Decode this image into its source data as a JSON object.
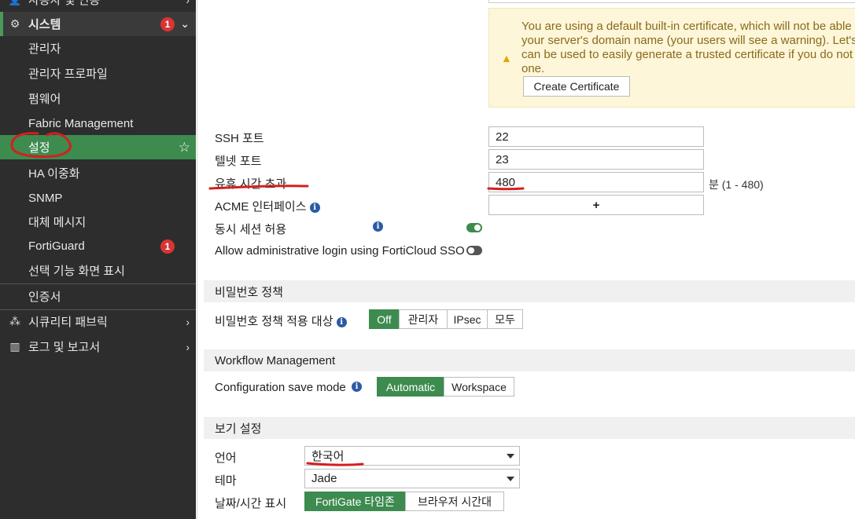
{
  "sidebar": {
    "partial_top_label": "사용자 및 인증",
    "system": {
      "label": "시스템",
      "badge": "1"
    },
    "sub_items": [
      {
        "label": "관리자"
      },
      {
        "label": "관리자 프로파일"
      },
      {
        "label": "펌웨어"
      },
      {
        "label": "Fabric Management"
      },
      {
        "label": "설정"
      },
      {
        "label": "HA 이중화"
      },
      {
        "label": "SNMP"
      },
      {
        "label": "대체 메시지"
      },
      {
        "label": "FortiGuard",
        "badge": "1"
      },
      {
        "label": "선택 기능 화면 표시"
      },
      {
        "label": "인증서"
      }
    ],
    "security_fabric": {
      "label": "시큐리티 패브릭"
    },
    "log_report": {
      "label": "로그 및 보고서"
    },
    "colors": {
      "bg": "#2d2d2d",
      "selected": "#3d8b4f",
      "badge": "#d93434"
    }
  },
  "certificate_warning": {
    "lines": [
      "You are using a default built-in certificate, which will not be able to",
      "your server's domain name (your users will see a warning). Let's E",
      "can be used to easily generate a trusted certificate if you do not ha",
      "one."
    ],
    "button": "Create Certificate"
  },
  "admin_settings": {
    "ssh_port": {
      "label": "SSH 포트",
      "value": "22"
    },
    "telnet_port": {
      "label": "텔넷 포트",
      "value": "23"
    },
    "idle_timeout": {
      "label": "유휴 시간 초과",
      "value": "480",
      "hint": "분 (1 - 480)"
    },
    "acme_interface": {
      "label": "ACME 인터페이스",
      "add_symbol": "+"
    },
    "concurrent_sessions": {
      "label": "동시 세션 허용",
      "enabled": true
    },
    "forticloud_sso": {
      "label": "Allow administrative login using FortiCloud SSO",
      "enabled": false
    }
  },
  "password_policy": {
    "title": "비밀번호 정책",
    "target_label": "비밀번호 정책 적용 대상",
    "options": [
      "Off",
      "관리자",
      "IPsec",
      "모두"
    ],
    "selected": "Off"
  },
  "workflow": {
    "title": "Workflow Management",
    "save_mode_label": "Configuration save mode",
    "options": [
      "Automatic",
      "Workspace"
    ],
    "selected": "Automatic"
  },
  "view_settings": {
    "title": "보기 설정",
    "language": {
      "label": "언어",
      "value": "한국어"
    },
    "theme": {
      "label": "테마",
      "value": "Jade"
    },
    "datetime": {
      "label": "날짜/시간 표시",
      "options": [
        "FortiGate 타임존",
        "브라우저 시간대"
      ],
      "selected": "FortiGate 타임존"
    }
  }
}
